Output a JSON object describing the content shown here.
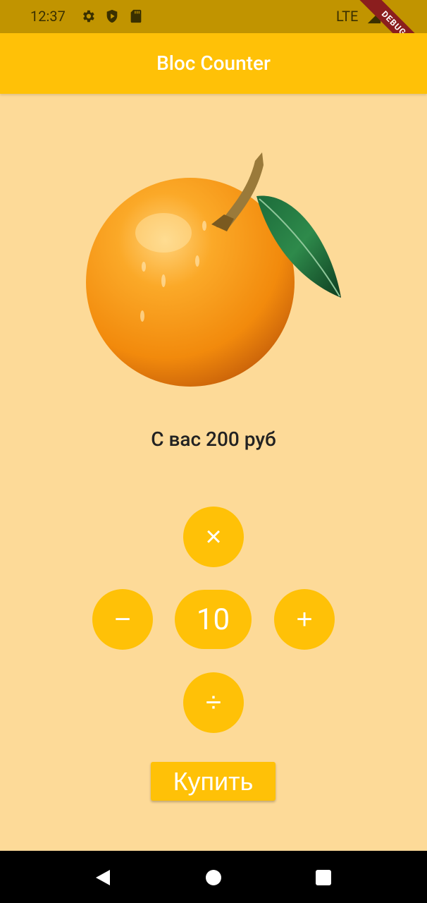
{
  "status_bar": {
    "time": "12:37",
    "icons": [
      "gear-icon",
      "shield-play-icon",
      "sd-card-icon"
    ],
    "network": "LTE",
    "debug_label": "DEBUG"
  },
  "app_bar": {
    "title": "Bloc Counter"
  },
  "product": {
    "image": "orange-fruit"
  },
  "price": {
    "text": "С вас 200 руб"
  },
  "controls": {
    "multiply": "×",
    "minus": "−",
    "plus": "+",
    "divide": "÷",
    "count": "10"
  },
  "buy_button": {
    "label": "Купить"
  },
  "nav_bar": {
    "icons": [
      "back-icon",
      "home-icon",
      "recents-icon"
    ]
  },
  "colors": {
    "accent": "#FFC107",
    "status_bar": "#C19400",
    "background": "#FDDA98"
  }
}
